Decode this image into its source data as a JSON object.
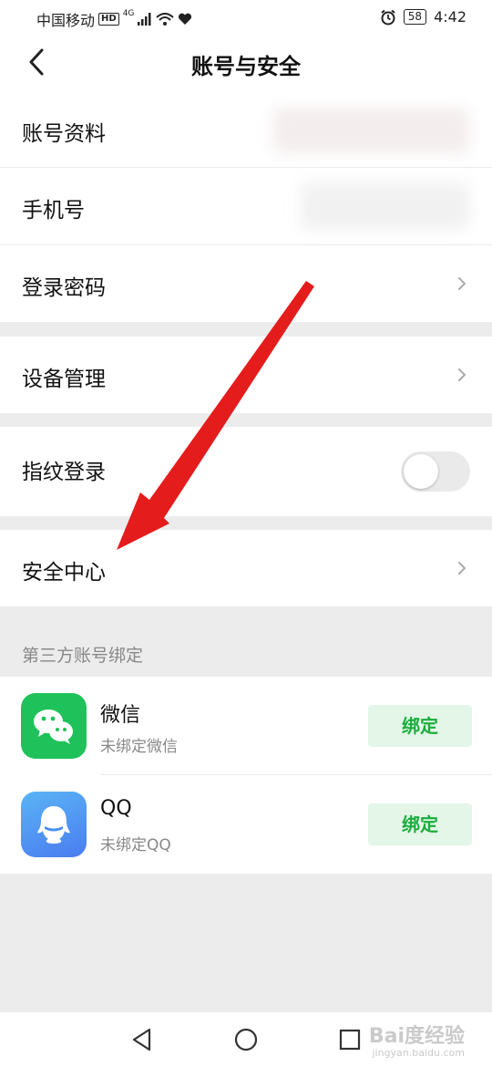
{
  "status_bar": {
    "carrier": "中国移动",
    "network_badge": "HD",
    "signal_type": "4G",
    "battery": "58",
    "time": "4:42"
  },
  "header": {
    "title": "账号与安全"
  },
  "rows": {
    "account_info": "账号资料",
    "phone": "手机号",
    "login_password": "登录密码",
    "device_manage": "设备管理",
    "fingerprint_login": "指纹登录",
    "security_center": "安全中心"
  },
  "fingerprint_toggle_on": false,
  "third_party": {
    "section_title": "第三方账号绑定",
    "wechat": {
      "name": "微信",
      "status": "未绑定微信",
      "button": "绑定"
    },
    "qq": {
      "name": "QQ",
      "status": "未绑定QQ",
      "button": "绑定"
    }
  },
  "watermark": {
    "text": "Bai度经验",
    "sub": "jingyan.baidu.com"
  },
  "colors": {
    "accent_green": "#1aad3c",
    "arrow_red": "#e51c1c",
    "wechat_green": "#1fc25a",
    "qq_blue": "#4a8ff0"
  }
}
